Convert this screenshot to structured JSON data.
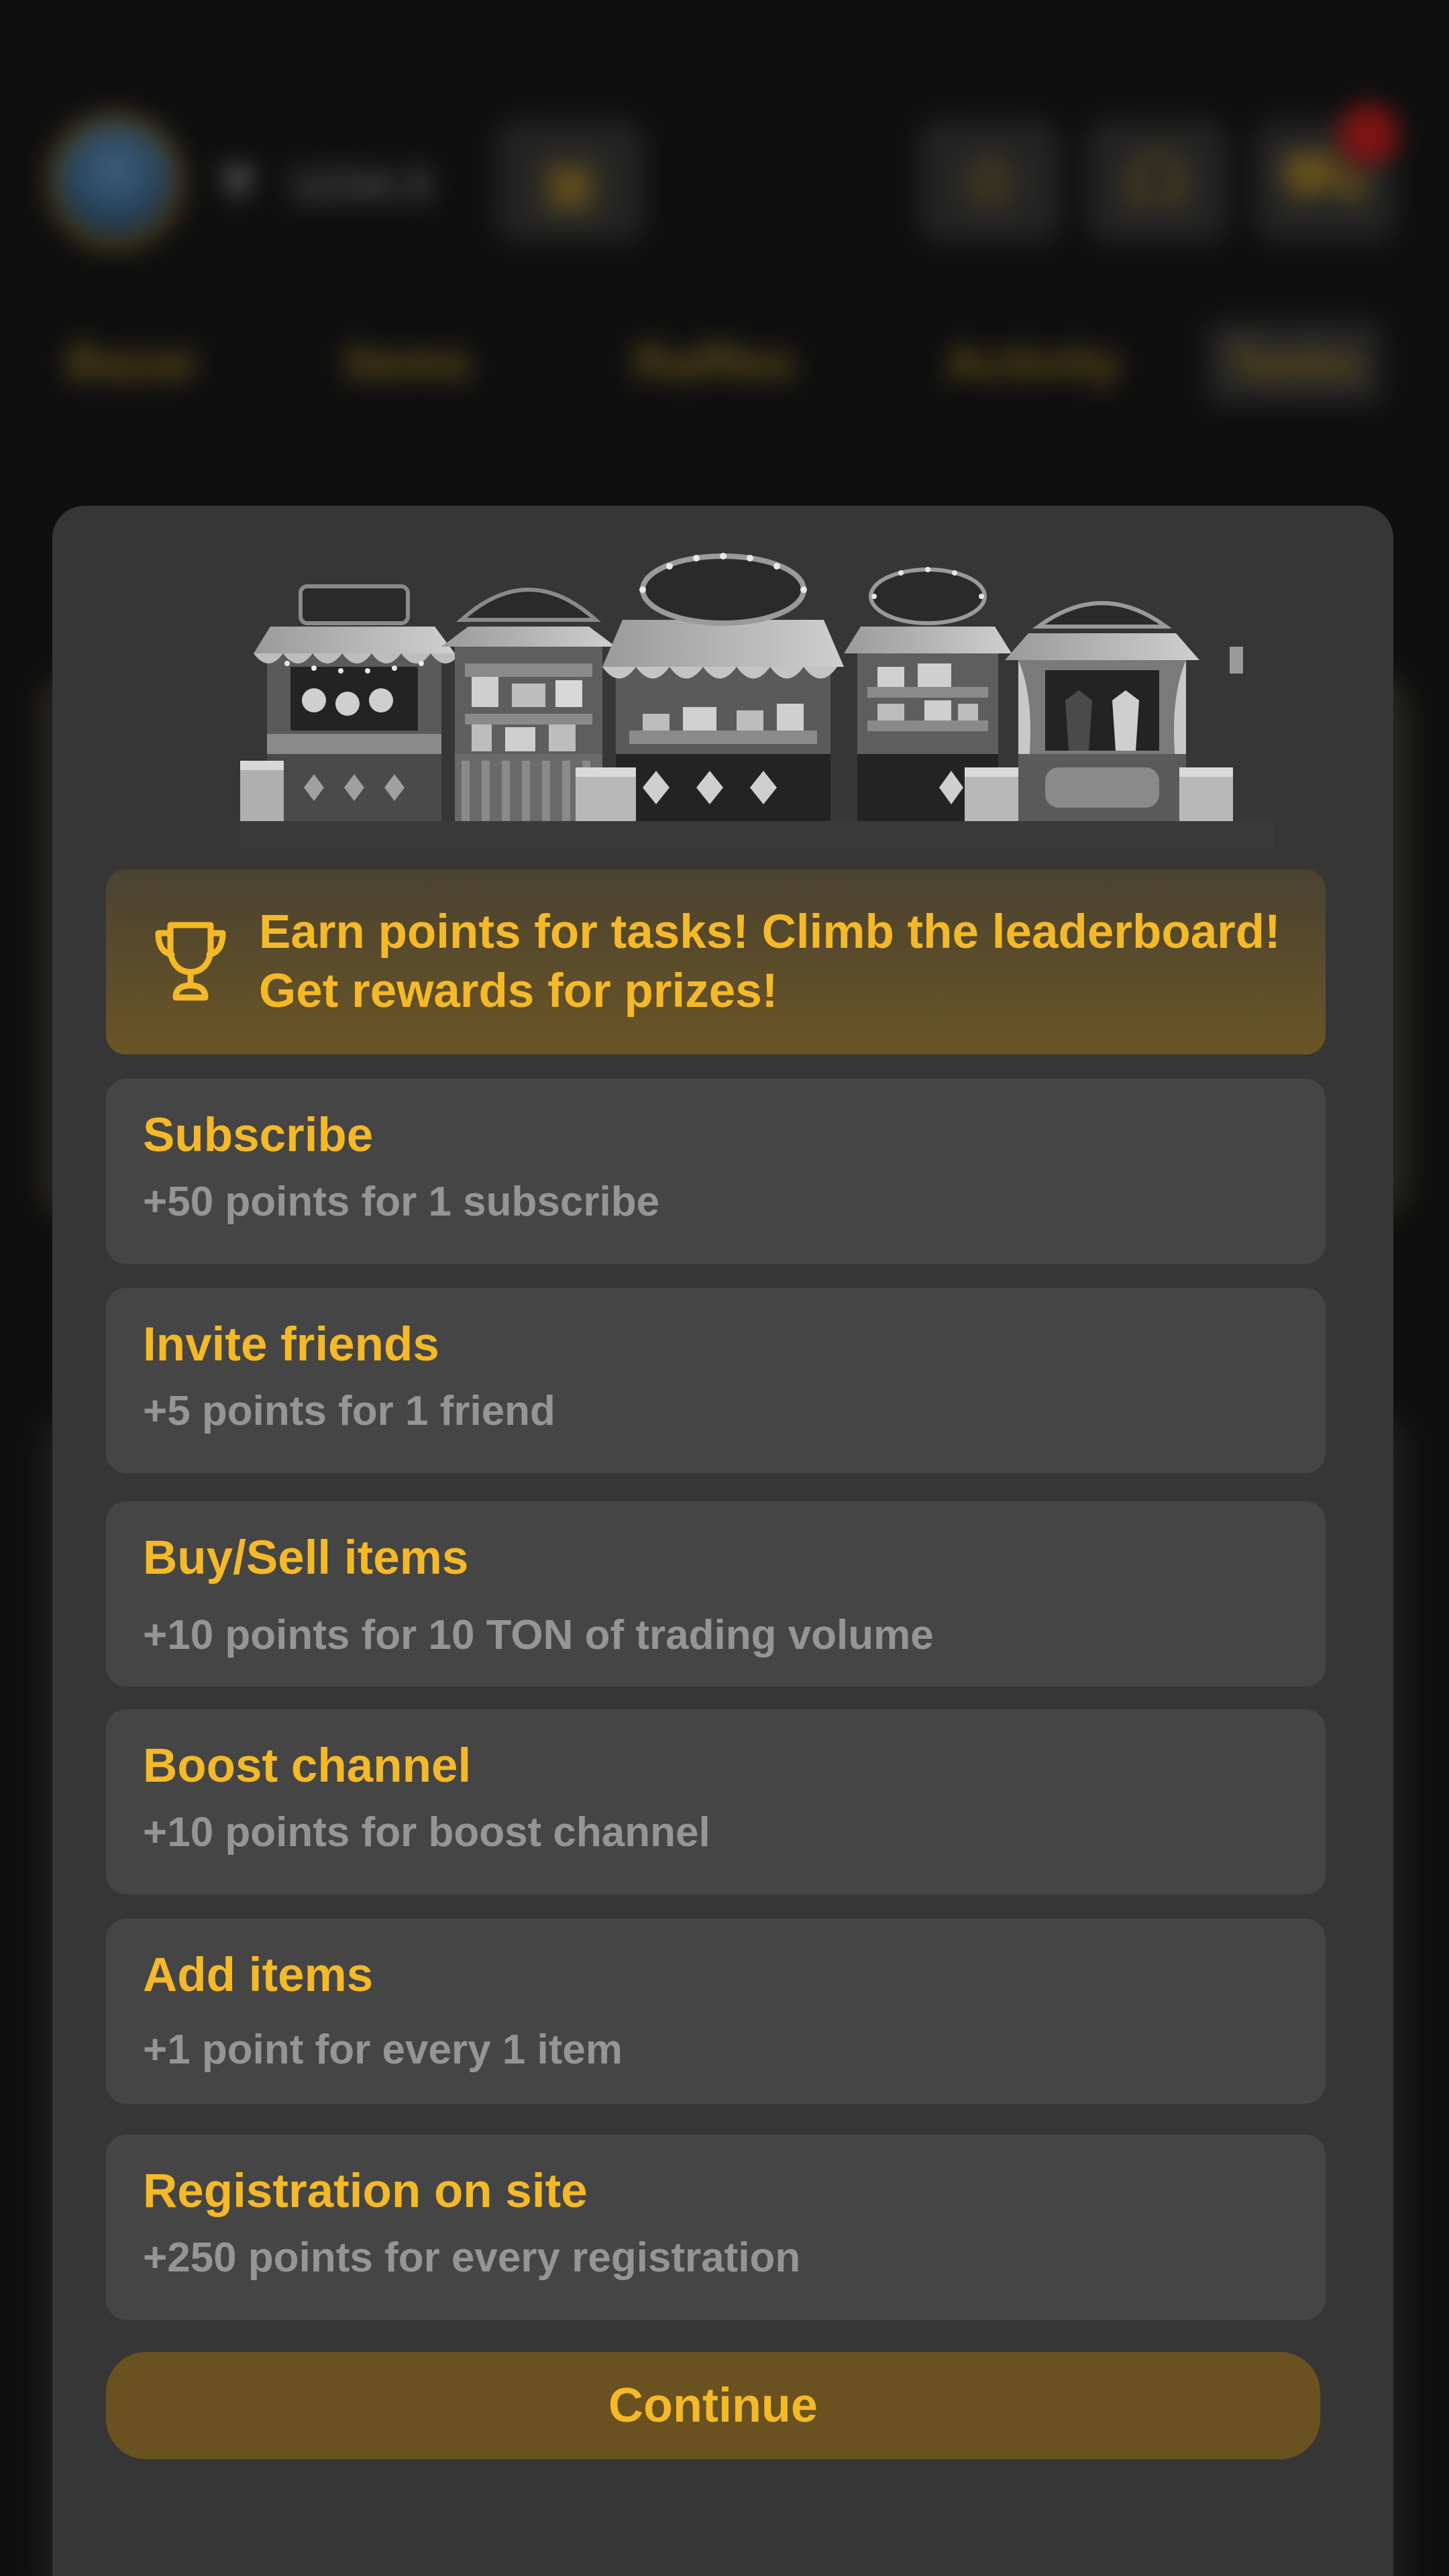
{
  "header": {
    "balance": "1234.5",
    "balance_icon": "ton-diamond-icon",
    "wallet_icon": "wallet-icon",
    "leaderboard_icon": "trophy-icon",
    "support_icon": "headset-icon",
    "cart_icon": "cart-icon"
  },
  "nav": {
    "tabs": [
      {
        "label": "Bazar"
      },
      {
        "label": "Items"
      },
      {
        "label": "Raffles"
      },
      {
        "label": "Activity"
      },
      {
        "label": "Tasks",
        "active": true
      }
    ]
  },
  "modal": {
    "hero_image": "market-stalls-illustration",
    "banner": {
      "icon": "trophy-icon",
      "line1": "Earn points for tasks! Climb the leaderboard!",
      "line2": "Get rewards for prizes!"
    },
    "tasks": [
      {
        "title": "Subscribe",
        "reward": "+50 points for 1 subscribe"
      },
      {
        "title": "Invite friends",
        "reward": "+5 points for 1 friend"
      },
      {
        "title": "Buy/Sell items",
        "reward": "+10 points for 10 TON of trading volume"
      },
      {
        "title": "Boost channel",
        "reward": "+10 points for boost channel"
      },
      {
        "title": "Add items",
        "reward": "+1 point for every 1 item"
      },
      {
        "title": "Registration on site",
        "reward": "+250 points for every registration"
      }
    ],
    "continue_label": "Continue"
  },
  "colors": {
    "accent": "#f5b928",
    "modal_bg": "#363636",
    "card_bg": "#454545",
    "banner_bg": "#5a4a2a",
    "button_bg": "#6a5220",
    "muted_text": "#959595",
    "badge": "#e01e1e"
  }
}
